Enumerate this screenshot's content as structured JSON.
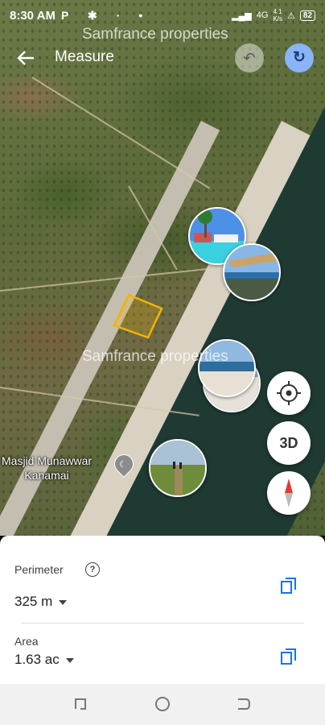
{
  "status_bar": {
    "time": "8:30 AM",
    "left_icons": "P ✱ ∙ •",
    "network": "4G",
    "speed_value": "4.1",
    "speed_unit": "K/s",
    "battery": "82"
  },
  "watermark": "Samfrance properties",
  "header": {
    "title": "Measure",
    "back_icon": "arrow-back-icon",
    "undo_icon": "undo-icon",
    "redo_icon": "redo-icon"
  },
  "map": {
    "place_label_line1": "Masjid Munawwar",
    "place_label_line2": "Kanamai",
    "measured_area_color": "#f4b400",
    "controls": {
      "locate_icon": "my-location-icon",
      "three_d_label": "3D",
      "compass_icon": "compass-icon"
    }
  },
  "measurements": {
    "perimeter_label": "Perimeter",
    "perimeter_value": "325 m",
    "area_label": "Area",
    "area_value": "1.63 ac",
    "copy_color": "#1a73e8"
  }
}
